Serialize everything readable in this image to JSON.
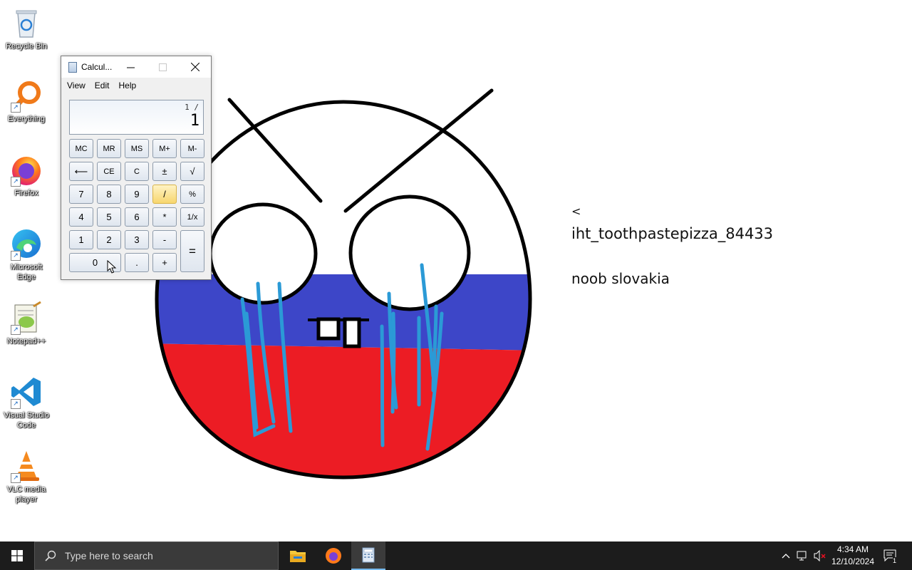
{
  "desktop": {
    "icons": [
      {
        "label": "Recycle Bin",
        "icon": "recycle-bin-icon"
      },
      {
        "label": "Everything",
        "icon": "everything-search-icon"
      },
      {
        "label": "Firefox",
        "icon": "firefox-icon"
      },
      {
        "label": "Microsoft Edge",
        "icon": "edge-icon"
      },
      {
        "label": "Notepad++",
        "icon": "notepadpp-icon"
      },
      {
        "label": "Visual Studio Code",
        "icon": "vscode-icon"
      },
      {
        "label": "VLC media player",
        "icon": "vlc-icon"
      }
    ]
  },
  "note": {
    "lines": [
      "<",
      "iht_toothpastepizza_84433",
      "noob slovakia"
    ]
  },
  "drawing": {
    "colors": {
      "white": "#ffffff",
      "blue": "#3d46c8",
      "red": "#ec1c24",
      "tears": "#2b9ad6",
      "outline": "#000000"
    }
  },
  "calculator": {
    "title": "Calcul...",
    "menu": [
      "View",
      "Edit",
      "Help"
    ],
    "display": {
      "history": "1 /",
      "value": "1"
    },
    "buttons": {
      "mc": "MC",
      "mr": "MR",
      "ms": "MS",
      "mplus": "M+",
      "mminus": "M-",
      "back": "⟵",
      "ce": "CE",
      "c": "C",
      "plusminus": "±",
      "sqrt": "√",
      "n7": "7",
      "n8": "8",
      "n9": "9",
      "div": "/",
      "pct": "%",
      "n4": "4",
      "n5": "5",
      "n6": "6",
      "mul": "*",
      "recip": "1/x",
      "n1": "1",
      "n2": "2",
      "n3": "3",
      "sub": "-",
      "eq": "=",
      "n0": "0",
      "dot": ".",
      "add": "+"
    }
  },
  "taskbar": {
    "search_placeholder": "Type here to search",
    "time": "4:34 AM",
    "date": "12/10/2024",
    "notification_count": "1"
  }
}
